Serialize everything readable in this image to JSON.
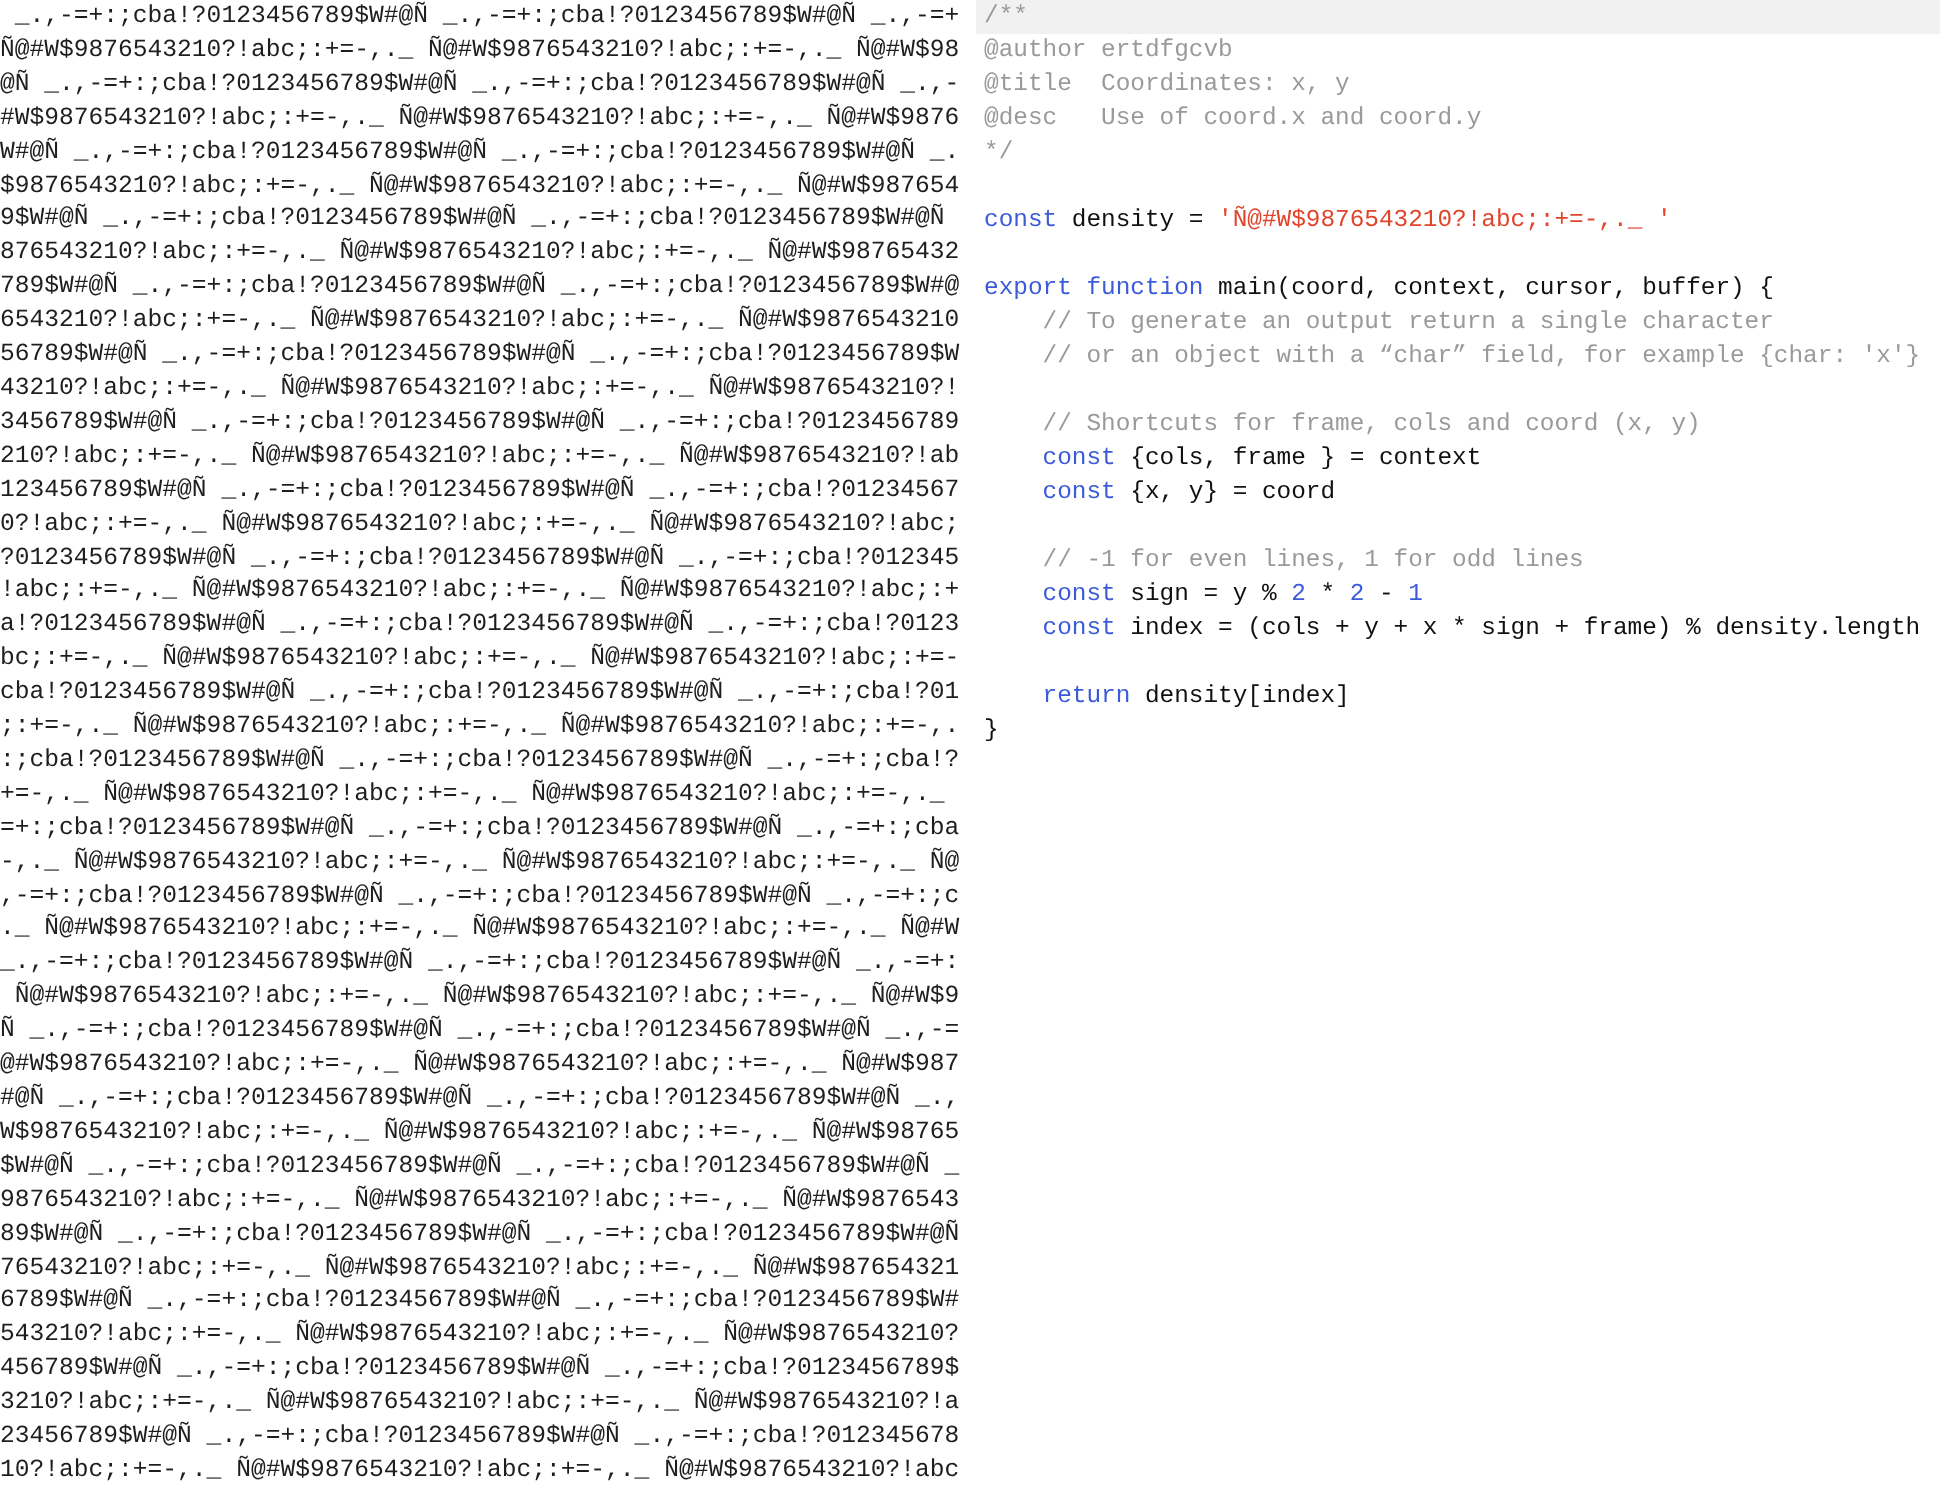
{
  "output": {
    "rows": [
      " _.,-=+:;cba!?0123456789$W#@Ñ _.,-=+:;cba!?0123456789$W#@Ñ _.,-=+",
      "Ñ@#W$9876543210?!abc;:+=-,._ Ñ@#W$9876543210?!abc;:+=-,._ Ñ@#W$98",
      "@Ñ _.,-=+:;cba!?0123456789$W#@Ñ _.,-=+:;cba!?0123456789$W#@Ñ _.,-",
      "#W$9876543210?!abc;:+=-,._ Ñ@#W$9876543210?!abc;:+=-,._ Ñ@#W$9876",
      "W#@Ñ _.,-=+:;cba!?0123456789$W#@Ñ _.,-=+:;cba!?0123456789$W#@Ñ _.",
      "$9876543210?!abc;:+=-,._ Ñ@#W$9876543210?!abc;:+=-,._ Ñ@#W$987654",
      "9$W#@Ñ _.,-=+:;cba!?0123456789$W#@Ñ _.,-=+:;cba!?0123456789$W#@Ñ ",
      "876543210?!abc;:+=-,._ Ñ@#W$9876543210?!abc;:+=-,._ Ñ@#W$98765432",
      "789$W#@Ñ _.,-=+:;cba!?0123456789$W#@Ñ _.,-=+:;cba!?0123456789$W#@",
      "6543210?!abc;:+=-,._ Ñ@#W$9876543210?!abc;:+=-,._ Ñ@#W$9876543210",
      "56789$W#@Ñ _.,-=+:;cba!?0123456789$W#@Ñ _.,-=+:;cba!?0123456789$W",
      "43210?!abc;:+=-,._ Ñ@#W$9876543210?!abc;:+=-,._ Ñ@#W$9876543210?!",
      "3456789$W#@Ñ _.,-=+:;cba!?0123456789$W#@Ñ _.,-=+:;cba!?0123456789",
      "210?!abc;:+=-,._ Ñ@#W$9876543210?!abc;:+=-,._ Ñ@#W$9876543210?!ab",
      "123456789$W#@Ñ _.,-=+:;cba!?0123456789$W#@Ñ _.,-=+:;cba!?01234567",
      "0?!abc;:+=-,._ Ñ@#W$9876543210?!abc;:+=-,._ Ñ@#W$9876543210?!abc;",
      "?0123456789$W#@Ñ _.,-=+:;cba!?0123456789$W#@Ñ _.,-=+:;cba!?012345",
      "!abc;:+=-,._ Ñ@#W$9876543210?!abc;:+=-,._ Ñ@#W$9876543210?!abc;:+",
      "a!?0123456789$W#@Ñ _.,-=+:;cba!?0123456789$W#@Ñ _.,-=+:;cba!?0123",
      "bc;:+=-,._ Ñ@#W$9876543210?!abc;:+=-,._ Ñ@#W$9876543210?!abc;:+=-",
      "cba!?0123456789$W#@Ñ _.,-=+:;cba!?0123456789$W#@Ñ _.,-=+:;cba!?01",
      ";:+=-,._ Ñ@#W$9876543210?!abc;:+=-,._ Ñ@#W$9876543210?!abc;:+=-,.",
      ":;cba!?0123456789$W#@Ñ _.,-=+:;cba!?0123456789$W#@Ñ _.,-=+:;cba!?",
      "+=-,._ Ñ@#W$9876543210?!abc;:+=-,._ Ñ@#W$9876543210?!abc;:+=-,._ ",
      "=+:;cba!?0123456789$W#@Ñ _.,-=+:;cba!?0123456789$W#@Ñ _.,-=+:;cba",
      "-,._ Ñ@#W$9876543210?!abc;:+=-,._ Ñ@#W$9876543210?!abc;:+=-,._ Ñ@",
      ",-=+:;cba!?0123456789$W#@Ñ _.,-=+:;cba!?0123456789$W#@Ñ _.,-=+:;c",
      "._ Ñ@#W$9876543210?!abc;:+=-,._ Ñ@#W$9876543210?!abc;:+=-,._ Ñ@#W",
      "_.,-=+:;cba!?0123456789$W#@Ñ _.,-=+:;cba!?0123456789$W#@Ñ _.,-=+:",
      " Ñ@#W$9876543210?!abc;:+=-,._ Ñ@#W$9876543210?!abc;:+=-,._ Ñ@#W$9",
      "Ñ _.,-=+:;cba!?0123456789$W#@Ñ _.,-=+:;cba!?0123456789$W#@Ñ _.,-=",
      "@#W$9876543210?!abc;:+=-,._ Ñ@#W$9876543210?!abc;:+=-,._ Ñ@#W$987",
      "#@Ñ _.,-=+:;cba!?0123456789$W#@Ñ _.,-=+:;cba!?0123456789$W#@Ñ _.,",
      "W$9876543210?!abc;:+=-,._ Ñ@#W$9876543210?!abc;:+=-,._ Ñ@#W$98765",
      "$W#@Ñ _.,-=+:;cba!?0123456789$W#@Ñ _.,-=+:;cba!?0123456789$W#@Ñ _",
      "9876543210?!abc;:+=-,._ Ñ@#W$9876543210?!abc;:+=-,._ Ñ@#W$9876543",
      "89$W#@Ñ _.,-=+:;cba!?0123456789$W#@Ñ _.,-=+:;cba!?0123456789$W#@Ñ",
      "76543210?!abc;:+=-,._ Ñ@#W$9876543210?!abc;:+=-,._ Ñ@#W$987654321",
      "6789$W#@Ñ _.,-=+:;cba!?0123456789$W#@Ñ _.,-=+:;cba!?0123456789$W#",
      "543210?!abc;:+=-,._ Ñ@#W$9876543210?!abc;:+=-,._ Ñ@#W$9876543210?",
      "456789$W#@Ñ _.,-=+:;cba!?0123456789$W#@Ñ _.,-=+:;cba!?0123456789$",
      "3210?!abc;:+=-,._ Ñ@#W$9876543210?!abc;:+=-,._ Ñ@#W$9876543210?!a",
      "23456789$W#@Ñ _.,-=+:;cba!?0123456789$W#@Ñ _.,-=+:;cba!?012345678",
      "10?!abc;:+=-,._ Ñ@#W$9876543210?!abc;:+=-,._ Ñ@#W$9876543210?!abc"
    ]
  },
  "editor": {
    "lines": [
      {
        "current": true,
        "indented": false,
        "tokens": [
          {
            "kind": "comment",
            "text": "/**"
          }
        ]
      },
      {
        "current": false,
        "indented": false,
        "tokens": [
          {
            "kind": "comment",
            "text": "@author ertdfgcvb"
          }
        ]
      },
      {
        "current": false,
        "indented": false,
        "tokens": [
          {
            "kind": "comment",
            "text": "@title  Coordinates: x, y"
          }
        ]
      },
      {
        "current": false,
        "indented": false,
        "tokens": [
          {
            "kind": "comment",
            "text": "@desc   Use of coord.x and coord.y"
          }
        ]
      },
      {
        "current": false,
        "indented": false,
        "tokens": [
          {
            "kind": "comment",
            "text": "*/"
          }
        ]
      },
      {
        "current": false
      },
      {
        "current": false,
        "indented": false,
        "tokens": [
          {
            "kind": "keyword",
            "text": "const"
          },
          {
            "kind": "plain",
            "text": " density = "
          },
          {
            "kind": "string",
            "text": "'Ñ@#W$9876543210?!abc;:+=-,._ '"
          }
        ]
      },
      {
        "current": false
      },
      {
        "current": false,
        "indented": false,
        "tokens": [
          {
            "kind": "keyword",
            "text": "export function"
          },
          {
            "kind": "plain",
            "text": " main(coord, context, cursor, buffer) {"
          }
        ]
      },
      {
        "current": false,
        "indented": true,
        "tokens": [
          {
            "kind": "comment",
            "text": "// To generate an output return a single character"
          }
        ]
      },
      {
        "current": false,
        "indented": true,
        "tokens": [
          {
            "kind": "comment",
            "text": "// or an object with a “char” field, for example {char: 'x'}"
          }
        ]
      },
      {
        "current": false
      },
      {
        "current": false,
        "indented": true,
        "tokens": [
          {
            "kind": "comment",
            "text": "// Shortcuts for frame, cols and coord (x, y)"
          }
        ]
      },
      {
        "current": false,
        "indented": true,
        "tokens": [
          {
            "kind": "keyword",
            "text": "const"
          },
          {
            "kind": "plain",
            "text": " {cols, frame } = context"
          }
        ]
      },
      {
        "current": false,
        "indented": true,
        "tokens": [
          {
            "kind": "keyword",
            "text": "const"
          },
          {
            "kind": "plain",
            "text": " {x, y} = coord"
          }
        ]
      },
      {
        "current": false
      },
      {
        "current": false,
        "indented": true,
        "tokens": [
          {
            "kind": "comment",
            "text": "// -1 for even lines, 1 for odd lines"
          }
        ]
      },
      {
        "current": false,
        "indented": true,
        "tokens": [
          {
            "kind": "keyword",
            "text": "const"
          },
          {
            "kind": "plain",
            "text": " sign = y % "
          },
          {
            "kind": "number",
            "text": "2"
          },
          {
            "kind": "plain",
            "text": " * "
          },
          {
            "kind": "number",
            "text": "2"
          },
          {
            "kind": "plain",
            "text": " - "
          },
          {
            "kind": "number",
            "text": "1"
          }
        ]
      },
      {
        "current": false,
        "indented": true,
        "tokens": [
          {
            "kind": "keyword",
            "text": "const"
          },
          {
            "kind": "plain",
            "text": " index = (cols + y + x * sign + frame) % density.length"
          }
        ]
      },
      {
        "current": false
      },
      {
        "current": false,
        "indented": true,
        "tokens": [
          {
            "kind": "keyword",
            "text": "return"
          },
          {
            "kind": "plain",
            "text": " density[index]"
          }
        ]
      },
      {
        "current": false,
        "indented": false,
        "tokens": [
          {
            "kind": "plain",
            "text": "}"
          }
        ]
      }
    ]
  }
}
